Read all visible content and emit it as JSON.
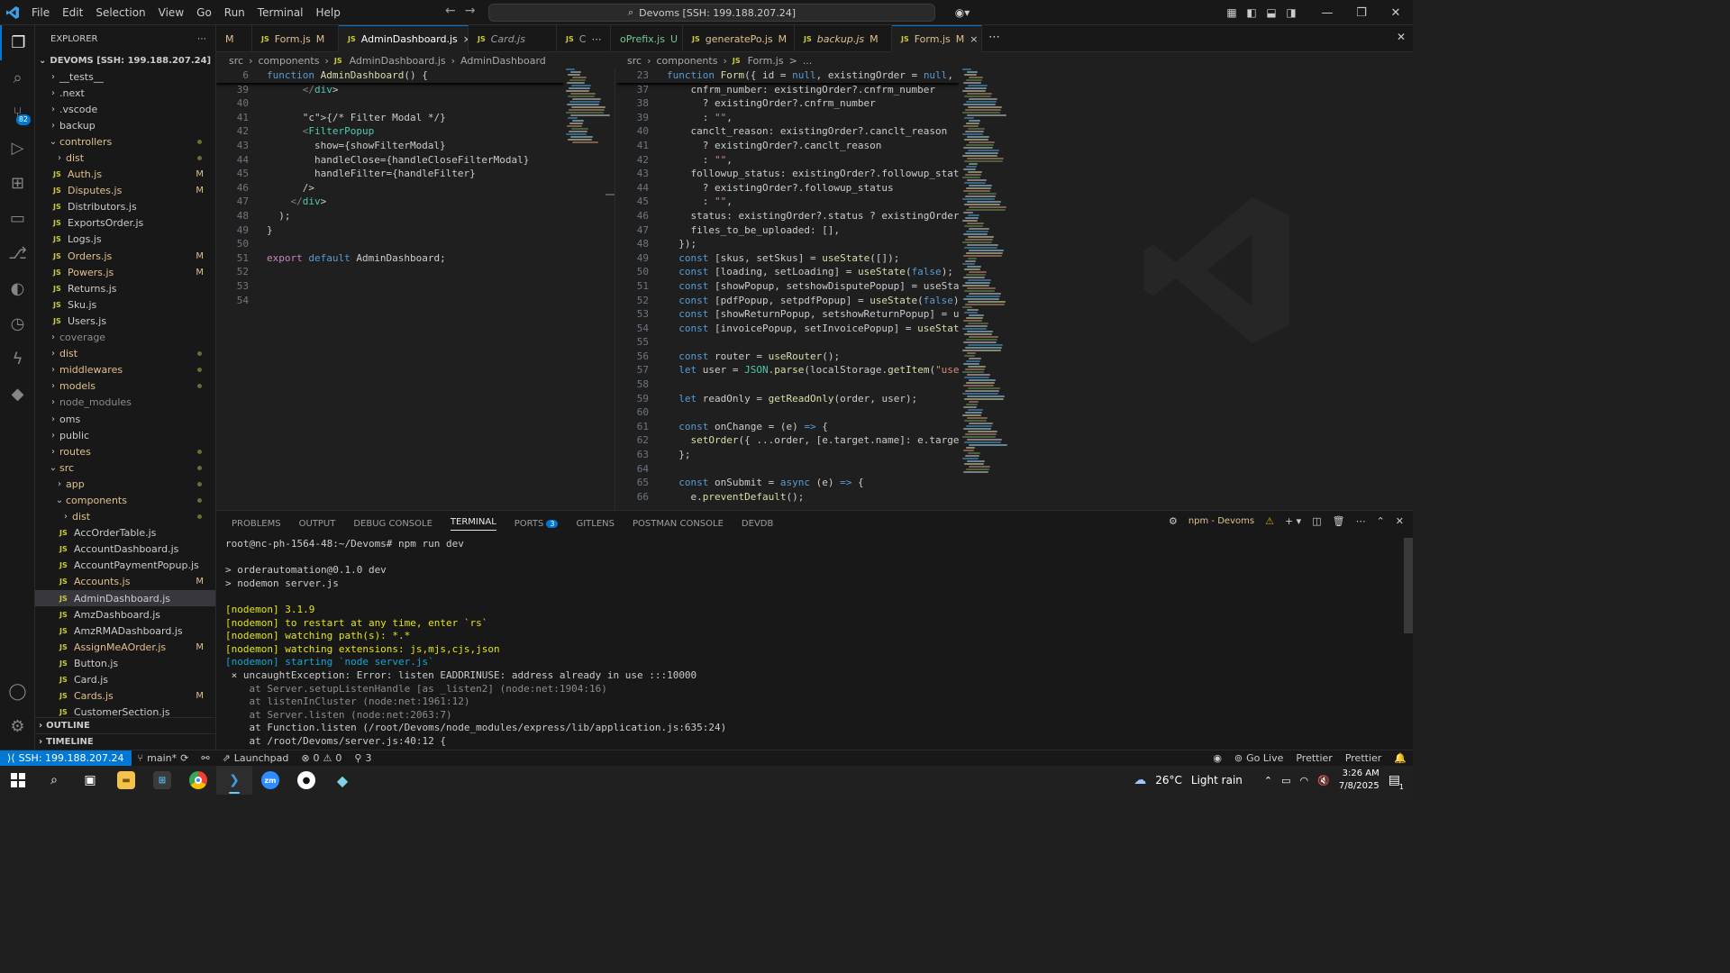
{
  "menu": [
    "File",
    "Edit",
    "Selection",
    "View",
    "Go",
    "Run",
    "Terminal",
    "Help"
  ],
  "search": {
    "label": "Devoms [SSH: 199.188.207.24]"
  },
  "sidebar": {
    "title": "EXPLORER",
    "root": "DEVOMS [SSH: 199.188.207.24]",
    "items": [
      {
        "label": "__tests__",
        "type": "folder",
        "indent": 1,
        "open": false
      },
      {
        "label": ".next",
        "type": "folder",
        "indent": 1,
        "open": false
      },
      {
        "label": ".vscode",
        "type": "folder",
        "indent": 1,
        "open": false
      },
      {
        "label": "backup",
        "type": "folder",
        "indent": 1,
        "open": false
      },
      {
        "label": "controllers",
        "type": "folder",
        "indent": 1,
        "open": true,
        "mod": true,
        "dot": true
      },
      {
        "label": "dist",
        "type": "folder",
        "indent": 2,
        "open": false,
        "mod": true,
        "dot": true
      },
      {
        "label": "Auth.js",
        "type": "file",
        "indent": 2,
        "mod": true,
        "mark": "M"
      },
      {
        "label": "Disputes.js",
        "type": "file",
        "indent": 2,
        "mod": true,
        "mark": "M"
      },
      {
        "label": "Distributors.js",
        "type": "file",
        "indent": 2
      },
      {
        "label": "ExportsOrder.js",
        "type": "file",
        "indent": 2
      },
      {
        "label": "Logs.js",
        "type": "file",
        "indent": 2
      },
      {
        "label": "Orders.js",
        "type": "file",
        "indent": 2,
        "mod": true,
        "mark": "M"
      },
      {
        "label": "Powers.js",
        "type": "file",
        "indent": 2,
        "mod": true,
        "mark": "M"
      },
      {
        "label": "Returns.js",
        "type": "file",
        "indent": 2
      },
      {
        "label": "Sku.js",
        "type": "file",
        "indent": 2
      },
      {
        "label": "Users.js",
        "type": "file",
        "indent": 2
      },
      {
        "label": "coverage",
        "type": "folder",
        "indent": 1,
        "dim": true
      },
      {
        "label": "dist",
        "type": "folder",
        "indent": 1,
        "mod": true,
        "dot": true
      },
      {
        "label": "middlewares",
        "type": "folder",
        "indent": 1,
        "mod": true,
        "dot": true
      },
      {
        "label": "models",
        "type": "folder",
        "indent": 1,
        "mod": true,
        "dot": true
      },
      {
        "label": "node_modules",
        "type": "folder",
        "indent": 1,
        "dim": true
      },
      {
        "label": "oms",
        "type": "folder",
        "indent": 1
      },
      {
        "label": "public",
        "type": "folder",
        "indent": 1
      },
      {
        "label": "routes",
        "type": "folder",
        "indent": 1,
        "mod": true,
        "dot": true
      },
      {
        "label": "src",
        "type": "folder",
        "indent": 1,
        "open": true,
        "mod": true,
        "dot": true
      },
      {
        "label": "app",
        "type": "folder",
        "indent": 2,
        "mod": true,
        "dot": true
      },
      {
        "label": "components",
        "type": "folder",
        "indent": 2,
        "open": true,
        "mod": true,
        "dot": true
      },
      {
        "label": "dist",
        "type": "folder",
        "indent": 3,
        "mod": true,
        "dot": true
      },
      {
        "label": "AccOrderTable.js",
        "type": "file",
        "indent": 3
      },
      {
        "label": "AccountDashboard.js",
        "type": "file",
        "indent": 3
      },
      {
        "label": "AccountPaymentPopup.js",
        "type": "file",
        "indent": 3
      },
      {
        "label": "Accounts.js",
        "type": "file",
        "indent": 3,
        "mod": true,
        "mark": "M"
      },
      {
        "label": "AdminDashboard.js",
        "type": "file",
        "indent": 3,
        "selected": true
      },
      {
        "label": "AmzDashboard.js",
        "type": "file",
        "indent": 3
      },
      {
        "label": "AmzRMADashboard.js",
        "type": "file",
        "indent": 3
      },
      {
        "label": "AssignMeAOrder.js",
        "type": "file",
        "indent": 3,
        "mod": true,
        "mark": "M"
      },
      {
        "label": "Button.js",
        "type": "file",
        "indent": 3
      },
      {
        "label": "Card.js",
        "type": "file",
        "indent": 3
      },
      {
        "label": "Cards.js",
        "type": "file",
        "indent": 3,
        "mod": true,
        "mark": "M"
      },
      {
        "label": "CustomerSection.js",
        "type": "file",
        "indent": 3
      }
    ],
    "outline": "OUTLINE",
    "timeline": "TIMELINE"
  },
  "tabs": [
    {
      "label": "M",
      "cls": "",
      "w": 40,
      "plain": true
    },
    {
      "label": "Form.js",
      "mark": "M",
      "cls": "mod",
      "w": 96
    },
    {
      "label": "AdminDashboard.js",
      "close": "×",
      "cls": "active",
      "w": 144
    },
    {
      "label": "Card.js",
      "cls": "it dim",
      "w": 98
    },
    {
      "label": "C",
      "extra": "⋯",
      "cls": "",
      "w": 60
    },
    {
      "label": "oPrefix.js",
      "mark": "U",
      "cls": "u",
      "w": 80,
      "nojs": true
    },
    {
      "label": "generatePo.js",
      "mark": "M",
      "cls": "mod",
      "w": 124
    },
    {
      "label": "backup.js",
      "mark": "M",
      "cls": "mod it",
      "w": 108
    },
    {
      "label": "Form.js",
      "mark": "M",
      "close": "×",
      "cls": "mod active",
      "w": 100
    }
  ],
  "left_editor": {
    "breadcrumb": [
      "src",
      "components",
      "AdminDashboard.js",
      "AdminDashboard"
    ],
    "sticky": {
      "ln": "6",
      "code": "function AdminDashboard() {"
    },
    "lines": [
      {
        "ln": "39",
        "code": "      </div>"
      },
      {
        "ln": "40",
        "code": ""
      },
      {
        "ln": "41",
        "code": "      {/* Filter Modal */}"
      },
      {
        "ln": "42",
        "code": "      <FilterPopup"
      },
      {
        "ln": "43",
        "code": "        show={showFilterModal}"
      },
      {
        "ln": "44",
        "code": "        handleClose={handleCloseFilterModal}"
      },
      {
        "ln": "45",
        "code": "        handleFilter={handleFilter}"
      },
      {
        "ln": "46",
        "code": "      />"
      },
      {
        "ln": "47",
        "code": "    </div>"
      },
      {
        "ln": "48",
        "code": "  );"
      },
      {
        "ln": "49",
        "code": "}"
      },
      {
        "ln": "50",
        "code": ""
      },
      {
        "ln": "51",
        "code": "export default AdminDashboard;"
      },
      {
        "ln": "52",
        "code": ""
      },
      {
        "ln": "53",
        "code": ""
      },
      {
        "ln": "54",
        "code": ""
      }
    ]
  },
  "right_editor": {
    "breadcrumb": [
      "src",
      "components",
      "Form.js",
      ">",
      "..."
    ],
    "sticky": {
      "ln": "23",
      "code": "function Form({ id = null, existingOrder = null, di"
    },
    "lines": [
      {
        "ln": "37",
        "code": "    cnfrm_number: existingOrder?.cnfrm_number"
      },
      {
        "ln": "38",
        "code": "      ? existingOrder?.cnfrm_number"
      },
      {
        "ln": "39",
        "code": "      : \"\","
      },
      {
        "ln": "40",
        "code": "    canclt_reason: existingOrder?.canclt_reason"
      },
      {
        "ln": "41",
        "code": "      ? existingOrder?.canclt_reason"
      },
      {
        "ln": "42",
        "code": "      : \"\","
      },
      {
        "ln": "43",
        "code": "    followup_status: existingOrder?.followup_status"
      },
      {
        "ln": "44",
        "code": "      ? existingOrder?.followup_status"
      },
      {
        "ln": "45",
        "code": "      : \"\","
      },
      {
        "ln": "46",
        "code": "    status: existingOrder?.status ? existingOrder?."
      },
      {
        "ln": "47",
        "code": "    files_to_be_uploaded: [],"
      },
      {
        "ln": "48",
        "code": "  });"
      },
      {
        "ln": "49",
        "code": "  const [skus, setSkus] = useState([]);"
      },
      {
        "ln": "50",
        "code": "  const [loading, setLoading] = useState(false);"
      },
      {
        "ln": "51",
        "code": "  const [showPopup, setshowDisputePopup] = useState"
      },
      {
        "ln": "52",
        "code": "  const [pdfPopup, setpdfPopup] = useState(false);"
      },
      {
        "ln": "53",
        "code": "  const [showReturnPopup, setshowReturnPopup] = use"
      },
      {
        "ln": "54",
        "code": "  const [invoicePopup, setInvoicePopup] = useState("
      },
      {
        "ln": "55",
        "code": ""
      },
      {
        "ln": "56",
        "code": "  const router = useRouter();"
      },
      {
        "ln": "57",
        "code": "  let user = JSON.parse(localStorage.getItem(\"user\""
      },
      {
        "ln": "58",
        "code": ""
      },
      {
        "ln": "59",
        "code": "  let readOnly = getReadOnly(order, user);"
      },
      {
        "ln": "60",
        "code": ""
      },
      {
        "ln": "61",
        "code": "  const onChange = (e) => {"
      },
      {
        "ln": "62",
        "code": "    setOrder({ ...order, [e.target.name]: e.target."
      },
      {
        "ln": "63",
        "code": "  };"
      },
      {
        "ln": "64",
        "code": ""
      },
      {
        "ln": "65",
        "code": "  const onSubmit = async (e) => {"
      },
      {
        "ln": "66",
        "code": "    e.preventDefault();"
      }
    ]
  },
  "panel": {
    "tabs": [
      "PROBLEMS",
      "OUTPUT",
      "DEBUG CONSOLE",
      "TERMINAL",
      "PORTS",
      "GITLENS",
      "POSTMAN CONSOLE",
      "DEVDB"
    ],
    "ports_badge": "3",
    "active": "TERMINAL",
    "task": "npm - Devoms",
    "terminal": [
      {
        "t": "root@nc-ph-1564-48:~/Devoms# npm run dev",
        "c": ""
      },
      {
        "t": "",
        "c": ""
      },
      {
        "t": "> orderautomation@0.1.0 dev",
        "c": ""
      },
      {
        "t": "> nodemon server.js",
        "c": ""
      },
      {
        "t": "",
        "c": ""
      },
      {
        "t": "[nodemon] 3.1.9",
        "c": "ty"
      },
      {
        "t": "[nodemon] to restart at any time, enter `rs`",
        "c": "ty"
      },
      {
        "t": "[nodemon] watching path(s): *.*",
        "c": "ty"
      },
      {
        "t": "[nodemon] watching extensions: js,mjs,cjs,json",
        "c": "ty"
      },
      {
        "t": "[nodemon] starting `node server.js`",
        "c": "tc"
      },
      {
        "t": " × uncaughtException: Error: listen EADDRINUSE: address already in use :::10000",
        "c": "err"
      },
      {
        "t": "    at Server.setupListenHandle [as _listen2] (node:net:1904:16)",
        "c": "tg"
      },
      {
        "t": "    at listenInCluster (node:net:1961:12)",
        "c": "tg"
      },
      {
        "t": "    at Server.listen (node:net:2063:7)",
        "c": "tg"
      },
      {
        "t": "    at Function.listen (/root/Devoms/node_modules/express/lib/application.js:635:24)",
        "c": ""
      },
      {
        "t": "    at /root/Devoms/server.js:40:12 {",
        "c": ""
      }
    ]
  },
  "status": {
    "remote": "SSH: 199.188.207.24",
    "branch": "main*",
    "launchpad": "Launchpad",
    "problems": "0",
    "warnings": "0",
    "ports": "3",
    "golive": "Go Live",
    "prettier1": "Prettier",
    "prettier2": "Prettier"
  },
  "taskbar": {
    "weather_temp": "26°C",
    "weather_desc": "Light rain",
    "time": "3:26 AM",
    "date": "7/8/2025",
    "notif": "1"
  },
  "colors": {
    "accent": "#0078d4",
    "modified": "#e2c08d",
    "untracked": "#73c991"
  }
}
